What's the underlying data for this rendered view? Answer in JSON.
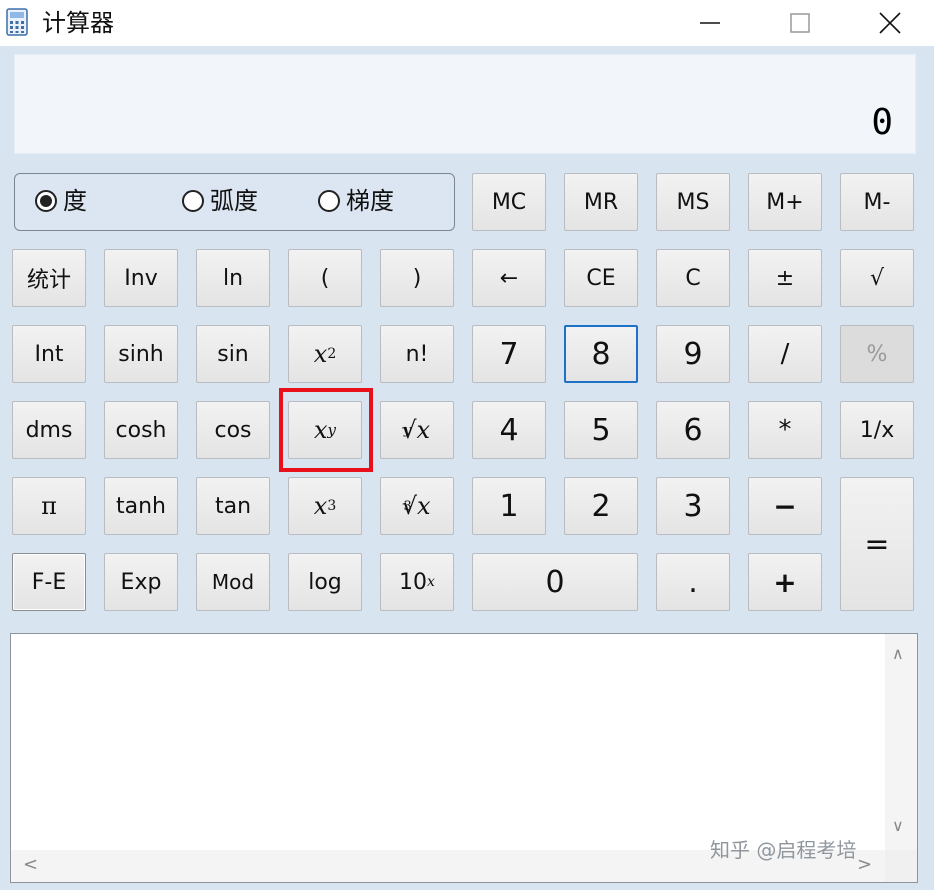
{
  "window": {
    "title": "计算器"
  },
  "display": {
    "value": "0"
  },
  "angle_mode": {
    "options": [
      {
        "label": "度",
        "selected": true
      },
      {
        "label": "弧度",
        "selected": false
      },
      {
        "label": "梯度",
        "selected": false
      }
    ]
  },
  "memory": {
    "mc": "MC",
    "mr": "MR",
    "ms": "MS",
    "mplus": "M+",
    "mminus": "M-"
  },
  "sci": {
    "stat": "统计",
    "inv": "Inv",
    "ln": "ln",
    "lparen": "(",
    "rparen": ")",
    "int": "Int",
    "sinh": "sinh",
    "sin": "sin",
    "x2_base": "x",
    "x2_exp": "2",
    "nfact": "n!",
    "dms": "dms",
    "cosh": "cosh",
    "cos": "cos",
    "xy_base": "x",
    "xy_exp": "y",
    "yroot_idx": "y",
    "yroot_rad": "√",
    "yroot_x": "x",
    "pi": "π",
    "tanh": "tanh",
    "tan": "tan",
    "x3_base": "x",
    "x3_exp": "3",
    "croot_idx": "3",
    "croot_rad": "√",
    "croot_x": "x",
    "fe": "F-E",
    "exp": "Exp",
    "mod": "Mod",
    "log": "log",
    "ten_base": "10",
    "ten_exp": "x"
  },
  "edit": {
    "back": "←",
    "ce": "CE",
    "c": "C",
    "neg": "±",
    "sqrt": "√"
  },
  "digits": {
    "d0": "0",
    "d1": "1",
    "d2": "2",
    "d3": "3",
    "d4": "4",
    "d5": "5",
    "d6": "6",
    "d7": "7",
    "d8": "8",
    "d9": "9",
    "dot": "."
  },
  "ops": {
    "div": "/",
    "pct": "%",
    "mul": "*",
    "recip": "1/x",
    "sub": "−",
    "add": "+",
    "eq": "="
  },
  "scroll": {
    "up": "∧",
    "down": "∨",
    "left": "<",
    "right": ">"
  },
  "watermark": "知乎 @启程考培"
}
